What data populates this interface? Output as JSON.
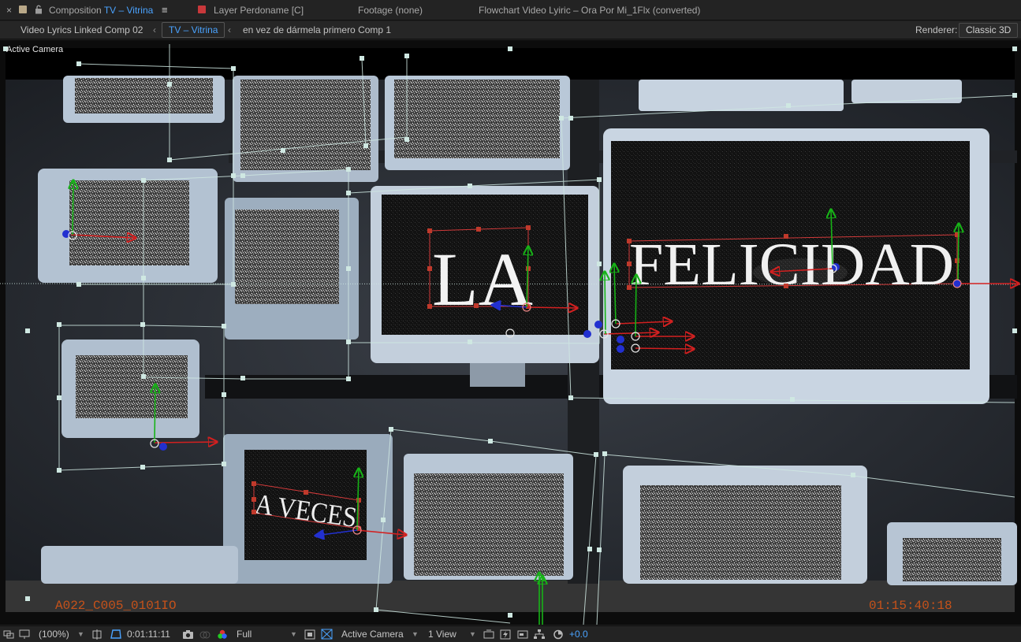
{
  "tabbar": {
    "close_glyph": "×",
    "comp_prefix": "Composition",
    "comp_name": "TV – Vitrina",
    "menu_glyph": "≡",
    "layer_tab": "Layer Perdoname [C]",
    "footage_tab": "Footage (none)",
    "flowchart_tab": "Flowchart Video Lyiric – Ora Por Mi_1Flx (converted)",
    "comp_swatch_color": "#b9a888",
    "layer_swatch_color": "#c8383b"
  },
  "breadcrumbs": {
    "items": [
      "Video Lyrics Linked Comp 02",
      "TV – Vitrina",
      "en vez  de  dármela  primero Comp 1"
    ],
    "renderer_label": "Renderer:",
    "renderer_value": "Classic 3D"
  },
  "viewer": {
    "label": "Active Camera",
    "title_text_1": "LA",
    "title_text_2": "FELICIDAD",
    "subtitle_text": "A VECES",
    "clip_name": "A022_C005_0101IO",
    "timecode_overlay": "01:15:40:18",
    "overlay_color": "#c6521a"
  },
  "bottombar": {
    "zoom": "(100%)",
    "current_time": "0:01:11:11",
    "resolution": "Full",
    "view": "Active Camera",
    "layout": "1 View",
    "exposure": "+0.0"
  },
  "colors": {
    "accent": "#4aa3ff",
    "handle": "#cfe8e2",
    "x_axis": "#d22020",
    "y_axis": "#17b317",
    "z_axis": "#2230d0"
  }
}
